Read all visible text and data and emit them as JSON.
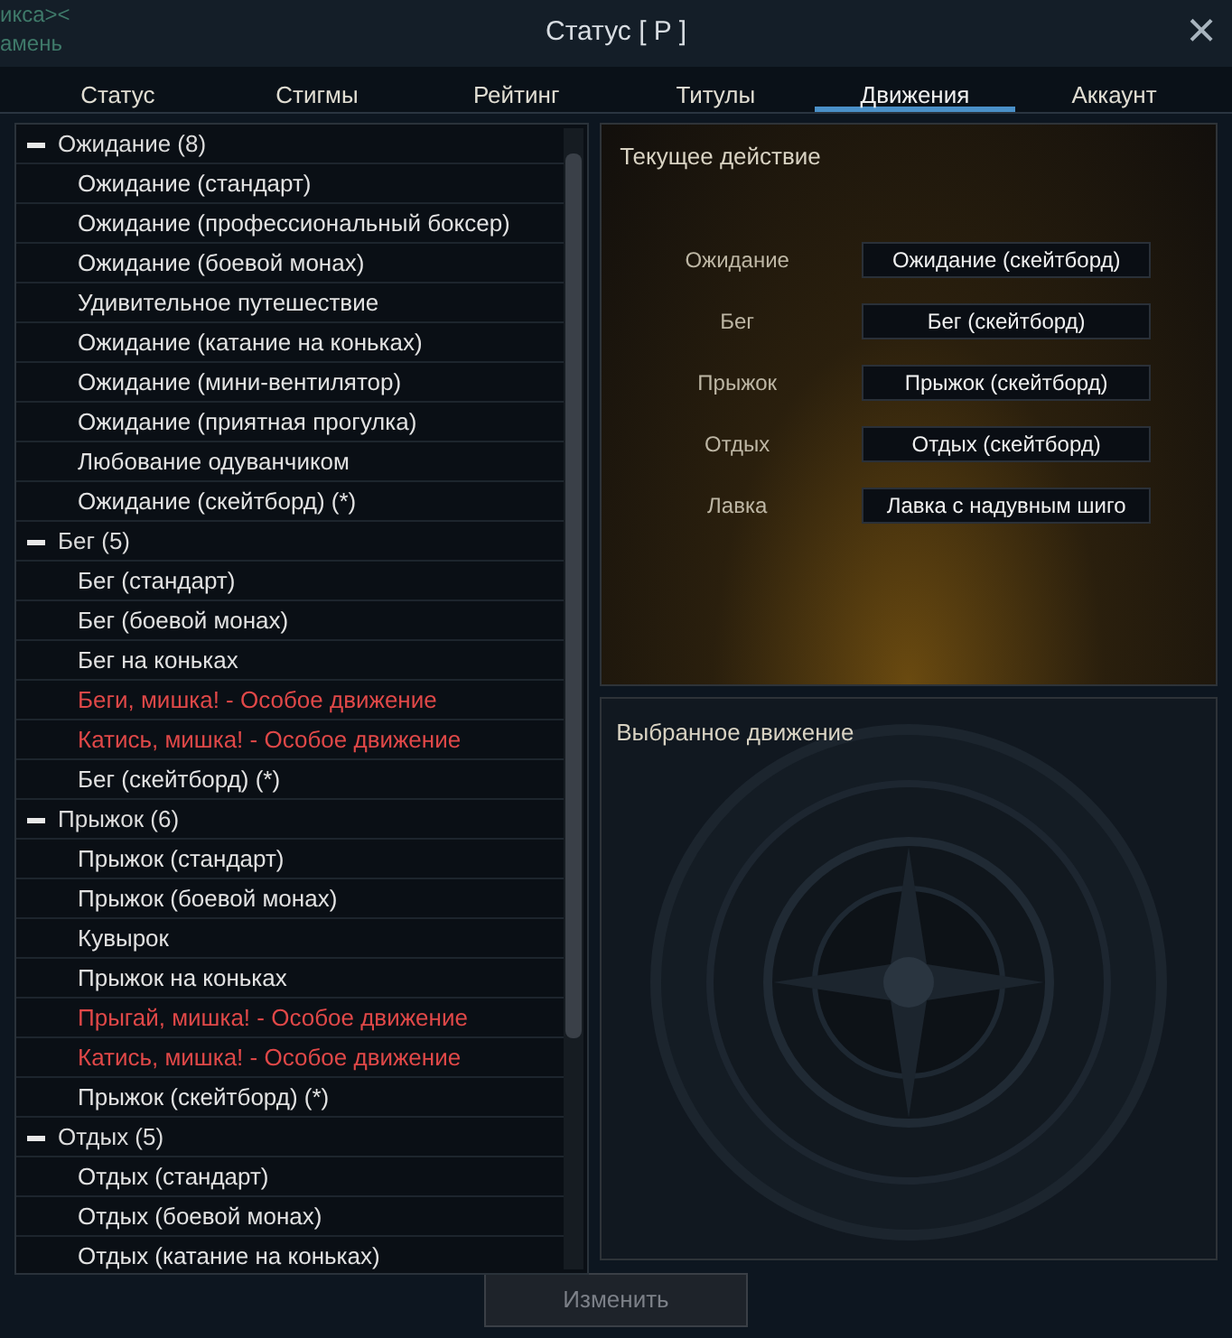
{
  "background_text": [
    "икса><",
    "амень"
  ],
  "window": {
    "title": "Статус [ P ]",
    "close": "×"
  },
  "tabs": [
    {
      "label": "Статус",
      "selected": false
    },
    {
      "label": "Стигмы",
      "selected": false
    },
    {
      "label": "Рейтинг",
      "selected": false
    },
    {
      "label": "Титулы",
      "selected": false
    },
    {
      "label": "Движения",
      "selected": true
    },
    {
      "label": "Аккаунт",
      "selected": false
    }
  ],
  "motion_list": [
    {
      "label": "Ожидание (8)",
      "expanded": true,
      "children": [
        {
          "label": "Ожидание (стандарт)",
          "special": false
        },
        {
          "label": "Ожидание (профессиональный боксер)",
          "special": false
        },
        {
          "label": "Ожидание (боевой монах)",
          "special": false
        },
        {
          "label": "Удивительное путешествие",
          "special": false
        },
        {
          "label": "Ожидание (катание на коньках)",
          "special": false
        },
        {
          "label": "Ожидание (мини-вентилятор)",
          "special": false
        },
        {
          "label": "Ожидание (приятная прогулка)",
          "special": false
        },
        {
          "label": "Любование одуванчиком",
          "special": false
        },
        {
          "label": "Ожидание (скейтборд) (*)",
          "special": false
        }
      ]
    },
    {
      "label": "Бег (5)",
      "expanded": true,
      "children": [
        {
          "label": "Бег (стандарт)",
          "special": false
        },
        {
          "label": "Бег (боевой монах)",
          "special": false
        },
        {
          "label": "Бег на коньках",
          "special": false
        },
        {
          "label": "Беги, мишка! - Особое движение",
          "special": true
        },
        {
          "label": "Катись, мишка! - Особое движение",
          "special": true
        },
        {
          "label": "Бег (скейтборд) (*)",
          "special": false
        }
      ]
    },
    {
      "label": "Прыжок (6)",
      "expanded": true,
      "children": [
        {
          "label": "Прыжок (стандарт)",
          "special": false
        },
        {
          "label": "Прыжок (боевой монах)",
          "special": false
        },
        {
          "label": "Кувырок",
          "special": false
        },
        {
          "label": "Прыжок на коньках",
          "special": false
        },
        {
          "label": "Прыгай, мишка! - Особое движение",
          "special": true
        },
        {
          "label": "Катись, мишка! - Особое движение",
          "special": true
        },
        {
          "label": "Прыжок (скейтборд) (*)",
          "special": false
        }
      ]
    },
    {
      "label": "Отдых (5)",
      "expanded": true,
      "children": [
        {
          "label": "Отдых (стандарт)",
          "special": false
        },
        {
          "label": "Отдых (боевой монах)",
          "special": false
        },
        {
          "label": "Отдых (катание на коньках)",
          "special": false
        }
      ]
    }
  ],
  "current_action": {
    "title": "Текущее действие",
    "rows": [
      {
        "label": "Ожидание",
        "value": "Ожидание (скейтборд)"
      },
      {
        "label": "Бег",
        "value": "Бег (скейтборд)"
      },
      {
        "label": "Прыжок",
        "value": "Прыжок (скейтборд)"
      },
      {
        "label": "Отдых",
        "value": "Отдых (скейтборд)"
      },
      {
        "label": "Лавка",
        "value": "Лавка с надувным шиго"
      }
    ]
  },
  "selected_motion": {
    "title": "Выбранное движение"
  },
  "change_button": {
    "label": "Изменить",
    "disabled": true
  }
}
